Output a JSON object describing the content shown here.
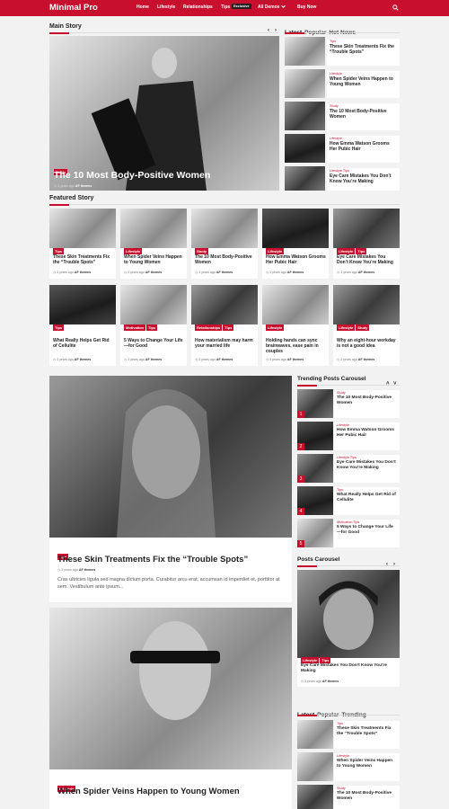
{
  "nav": {
    "logo": "Minimal Pro",
    "items": [
      "Home",
      "Lifestyle",
      "Relationships",
      "Tips",
      "All Demos",
      "Buy Now"
    ],
    "exclusive": "Exclusive",
    "search_icon": "search-icon",
    "chevron_icon": "chevron-down-icon"
  },
  "colors": {
    "accent": "#c8102e"
  },
  "main_story": {
    "heading": "Main Story",
    "tag": "Study",
    "title": "The 10 Most Body-Positive Women",
    "meta_time": "3 years ago",
    "meta_author": "AF themes",
    "prev": "‹",
    "next": "›"
  },
  "side_tabs": {
    "tabs": [
      "Latest",
      "Popular",
      "Hot News"
    ],
    "items": [
      {
        "cat": "Tips",
        "title": "These Skin Treatments Fix the “Trouble Spots”"
      },
      {
        "cat": "Lifestyle",
        "title": "When Spider Veins Happen to Young Women"
      },
      {
        "cat": "Study",
        "title": "The 10 Most Body-Positive Women"
      },
      {
        "cat": "Lifestyle",
        "title": "How Emma Watson Grooms Her Pubic Hair"
      },
      {
        "cat": "Lifestyle Tips",
        "title": "Eye Care Mistakes You Don’t Know You’re Making"
      }
    ]
  },
  "featured": {
    "heading": "Featured Story",
    "items": [
      {
        "tags": [
          "Tips"
        ],
        "title": "These Skin Treatments Fix the “Trouble Spots”",
        "time": "3 years ago",
        "author": "AF themes"
      },
      {
        "tags": [
          "Lifestyle"
        ],
        "title": "When Spider Veins Happen to Young Women",
        "time": "3 years ago",
        "author": "AF themes"
      },
      {
        "tags": [
          "Study"
        ],
        "title": "The 10 Most Body-Positive Women",
        "time": "3 years ago",
        "author": "AF themes"
      },
      {
        "tags": [
          "Lifestyle"
        ],
        "title": "How Emma Watson Grooms Her Pubic Hair",
        "time": "3 years ago",
        "author": "AF themes"
      },
      {
        "tags": [
          "Lifestyle",
          "Tips"
        ],
        "title": "Eye Care Mistakes You Don’t Know You’re Making",
        "time": "3 years ago",
        "author": "AF themes"
      },
      {
        "tags": [
          "Tips"
        ],
        "title": "What Really Helps Get Rid of Cellulite",
        "time": "3 years ago",
        "author": "AF themes"
      },
      {
        "tags": [
          "Motivation",
          "Tips"
        ],
        "title": "5 Ways to Change Your Life —for Good",
        "time": "3 years ago",
        "author": "AF themes"
      },
      {
        "tags": [
          "Relationships",
          "Tips"
        ],
        "title": "How materialism may harm your married life",
        "time": "3 years ago",
        "author": "AF themes"
      },
      {
        "tags": [
          "Lifestyle"
        ],
        "title": "Holding hands can sync brainwaves, ease pain in couples",
        "time": "3 years ago",
        "author": "AF themes"
      },
      {
        "tags": [
          "Lifestyle",
          "Study"
        ],
        "title": "Why an eight-hour workday is not a good idea",
        "time": "3 years ago",
        "author": "AF themes"
      }
    ]
  },
  "big_posts": [
    {
      "tag": "Tips",
      "title": "These Skin Treatments Fix the “Trouble Spots”",
      "time": "3 years ago",
      "author": "AF themes",
      "excerpt": "Cras ultricies ligula sed magna dictum porta. Curabitur arcu erat, accumsan id imperdiet et, porttitor at sem. Vestibulum ante ipsum..."
    },
    {
      "tag": "Lifestyle",
      "title": "When Spider Veins Happen to Young Women"
    }
  ],
  "trending": {
    "heading": "Trending Posts Carousel",
    "up": "˄",
    "down": "˅",
    "items": [
      {
        "n": "1",
        "cat": "Study",
        "title": "The 10 Most Body-Positive Women"
      },
      {
        "n": "2",
        "cat": "Lifestyle",
        "title": "How Emma Watson Grooms Her Pubic Hair"
      },
      {
        "n": "3",
        "cat": "Lifestyle Tips",
        "title": "Eye Care Mistakes You Don’t Know You’re Making"
      },
      {
        "n": "4",
        "cat": "Tips",
        "title": "What Really Helps Get Rid of Cellulite"
      },
      {
        "n": "5",
        "cat": "Motivation Tips",
        "title": "5 Ways to Change Your Life —for Good"
      }
    ]
  },
  "posts_carousel": {
    "heading": "Posts Carousel",
    "prev": "‹",
    "next": "›",
    "tags": [
      "Lifestyle",
      "Tips"
    ],
    "title": "Eye Care Mistakes You Don’t Know You’re Making",
    "time": "3 years ago",
    "author": "AF themes"
  },
  "bottom_tabs": {
    "tabs": [
      "Latest",
      "Popular",
      "Trending"
    ],
    "items": [
      {
        "cat": "Tips",
        "title": "These Skin Treatments Fix the “Trouble Spots”"
      },
      {
        "cat": "Lifestyle",
        "title": "When Spider Veins Happen to Young Women"
      },
      {
        "cat": "Study",
        "title": "The 10 Most Body-Positive Women"
      }
    ]
  }
}
